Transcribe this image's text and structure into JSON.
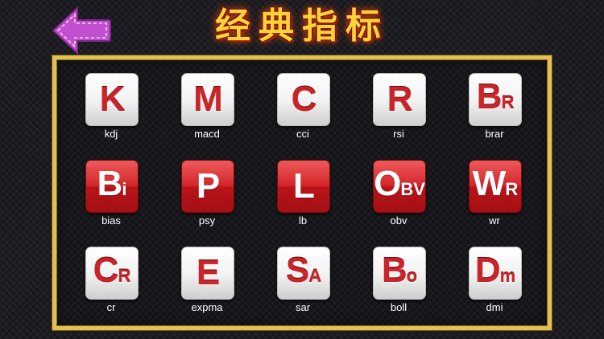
{
  "header": {
    "title": "经典指标",
    "back_icon": "arrow-left-icon",
    "back_color": "#c24fd0"
  },
  "colors": {
    "frame": "#e2c152",
    "tile_red": "#c9242a",
    "tile_white": "#ffffff"
  },
  "indicators": [
    {
      "big": "K",
      "small": "",
      "label": "kdj",
      "style": "white"
    },
    {
      "big": "M",
      "small": "",
      "label": "macd",
      "style": "white"
    },
    {
      "big": "C",
      "small": "",
      "label": "cci",
      "style": "white"
    },
    {
      "big": "R",
      "small": "",
      "label": "rsi",
      "style": "white"
    },
    {
      "big": "B",
      "small": "R",
      "label": "brar",
      "style": "white"
    },
    {
      "big": "B",
      "small": "i",
      "label": "bias",
      "style": "red"
    },
    {
      "big": "P",
      "small": "",
      "label": "psy",
      "style": "red"
    },
    {
      "big": "L",
      "small": "",
      "label": "lb",
      "style": "red"
    },
    {
      "big": "O",
      "small": "BV",
      "label": "obv",
      "style": "red"
    },
    {
      "big": "W",
      "small": "R",
      "label": "wr",
      "style": "red"
    },
    {
      "big": "C",
      "small": "R",
      "label": "cr",
      "style": "white"
    },
    {
      "big": "E",
      "small": "",
      "label": "expma",
      "style": "white"
    },
    {
      "big": "S",
      "small": "A",
      "label": "sar",
      "style": "white"
    },
    {
      "big": "B",
      "small": "o",
      "label": "boll",
      "style": "white"
    },
    {
      "big": "D",
      "small": "m",
      "label": "dmi",
      "style": "white"
    }
  ]
}
